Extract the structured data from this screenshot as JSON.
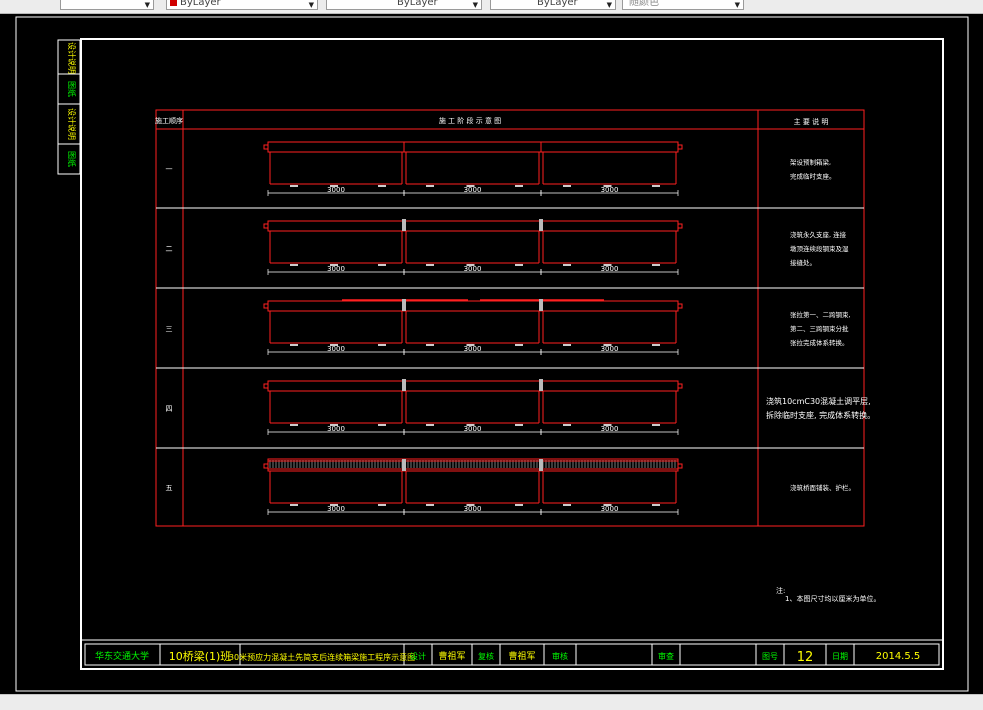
{
  "toolbar": {
    "layer_label": "ByLayer",
    "linetype_label": "ByLayer",
    "lineweight_label": "ByLayer",
    "plotstyle_label": "随颜色"
  },
  "side_tabs": [
    "设计说明",
    "图纸",
    "设计说明",
    "图纸"
  ],
  "table": {
    "col_seq": "施工顺序",
    "col_stage": "施 工 阶 段 示 意 图",
    "col_notes": "主 要 说 明",
    "rows": [
      {
        "seq": "一",
        "notes": [
          "架设预制箱梁,",
          "完成临时支座。"
        ]
      },
      {
        "seq": "二",
        "notes": [
          "浇筑永久支座, 连接",
          "墩顶连续段钢束及湿",
          "接缝处。"
        ]
      },
      {
        "seq": "三",
        "notes": [
          "张拉第一、二跨钢束,",
          "第二、三跨钢束分批",
          "张拉完成体系转换。"
        ]
      },
      {
        "seq": "四",
        "notes": [
          "浇筑10cmC30混凝土调平层,",
          "拆除临时支座, 完成体系转换。"
        ]
      },
      {
        "seq": "五",
        "notes": [
          "浇筑桥面铺装、护栏。"
        ]
      }
    ],
    "span_label": "3000"
  },
  "note": {
    "title": "注:",
    "text": "1、本图尺寸均以厘米为单位。"
  },
  "title_block": {
    "school": "华东交通大学",
    "class": "10桥梁(1)班",
    "drawing_title": "30米预应力混凝土先简支后连续箱梁施工程序示意图",
    "design_label": "设计",
    "designer": "曹祖军",
    "review_label": "复核",
    "reviewer": "曹祖军",
    "check_label": "审核",
    "approve_label": "审查",
    "sheet_label": "图号",
    "sheet_no": "12",
    "date_label": "日期",
    "date": "2014.5.5"
  }
}
